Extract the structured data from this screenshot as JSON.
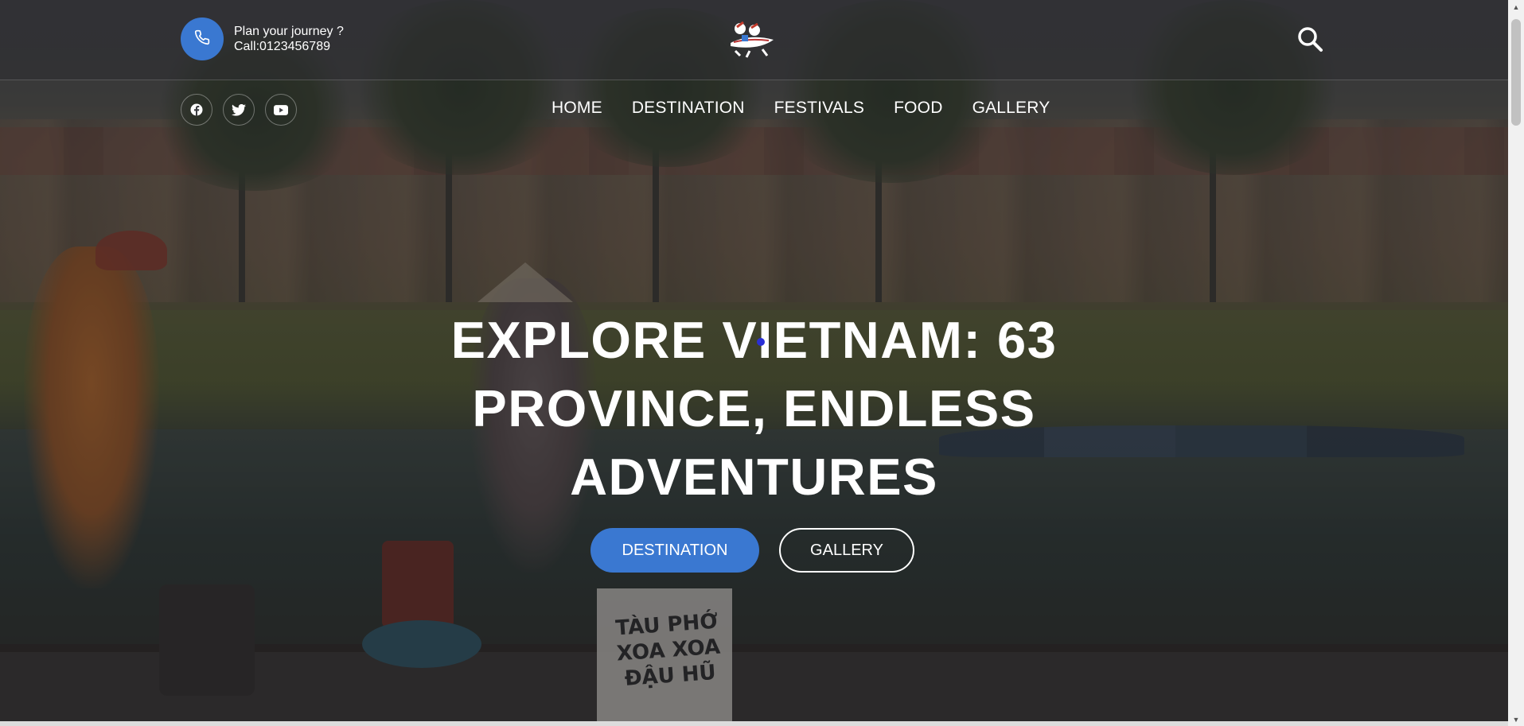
{
  "header": {
    "contact_line1": "Plan your journey ?",
    "contact_line2": "Call:0123456789",
    "accent_color": "#3a78d1",
    "icons": [
      "phone-icon",
      "logo",
      "search-icon"
    ]
  },
  "social": [
    "facebook-icon",
    "twitter-icon",
    "youtube-icon"
  ],
  "nav": {
    "items": [
      {
        "label": "HOME"
      },
      {
        "label": "DESTINATION"
      },
      {
        "label": "FESTIVALS"
      },
      {
        "label": "FOOD"
      },
      {
        "label": "GALLERY"
      }
    ]
  },
  "hero": {
    "headline_line1": "EXPLORE VIETNAM: 63",
    "headline_line2": "PROVINCE, ENDLESS",
    "headline_line3": "ADVENTURES",
    "primary_button": "DESTINATION",
    "secondary_button": "GALLERY",
    "sign_text": "TÀU PHỚ XOA XOA ĐẬU HŨ"
  }
}
